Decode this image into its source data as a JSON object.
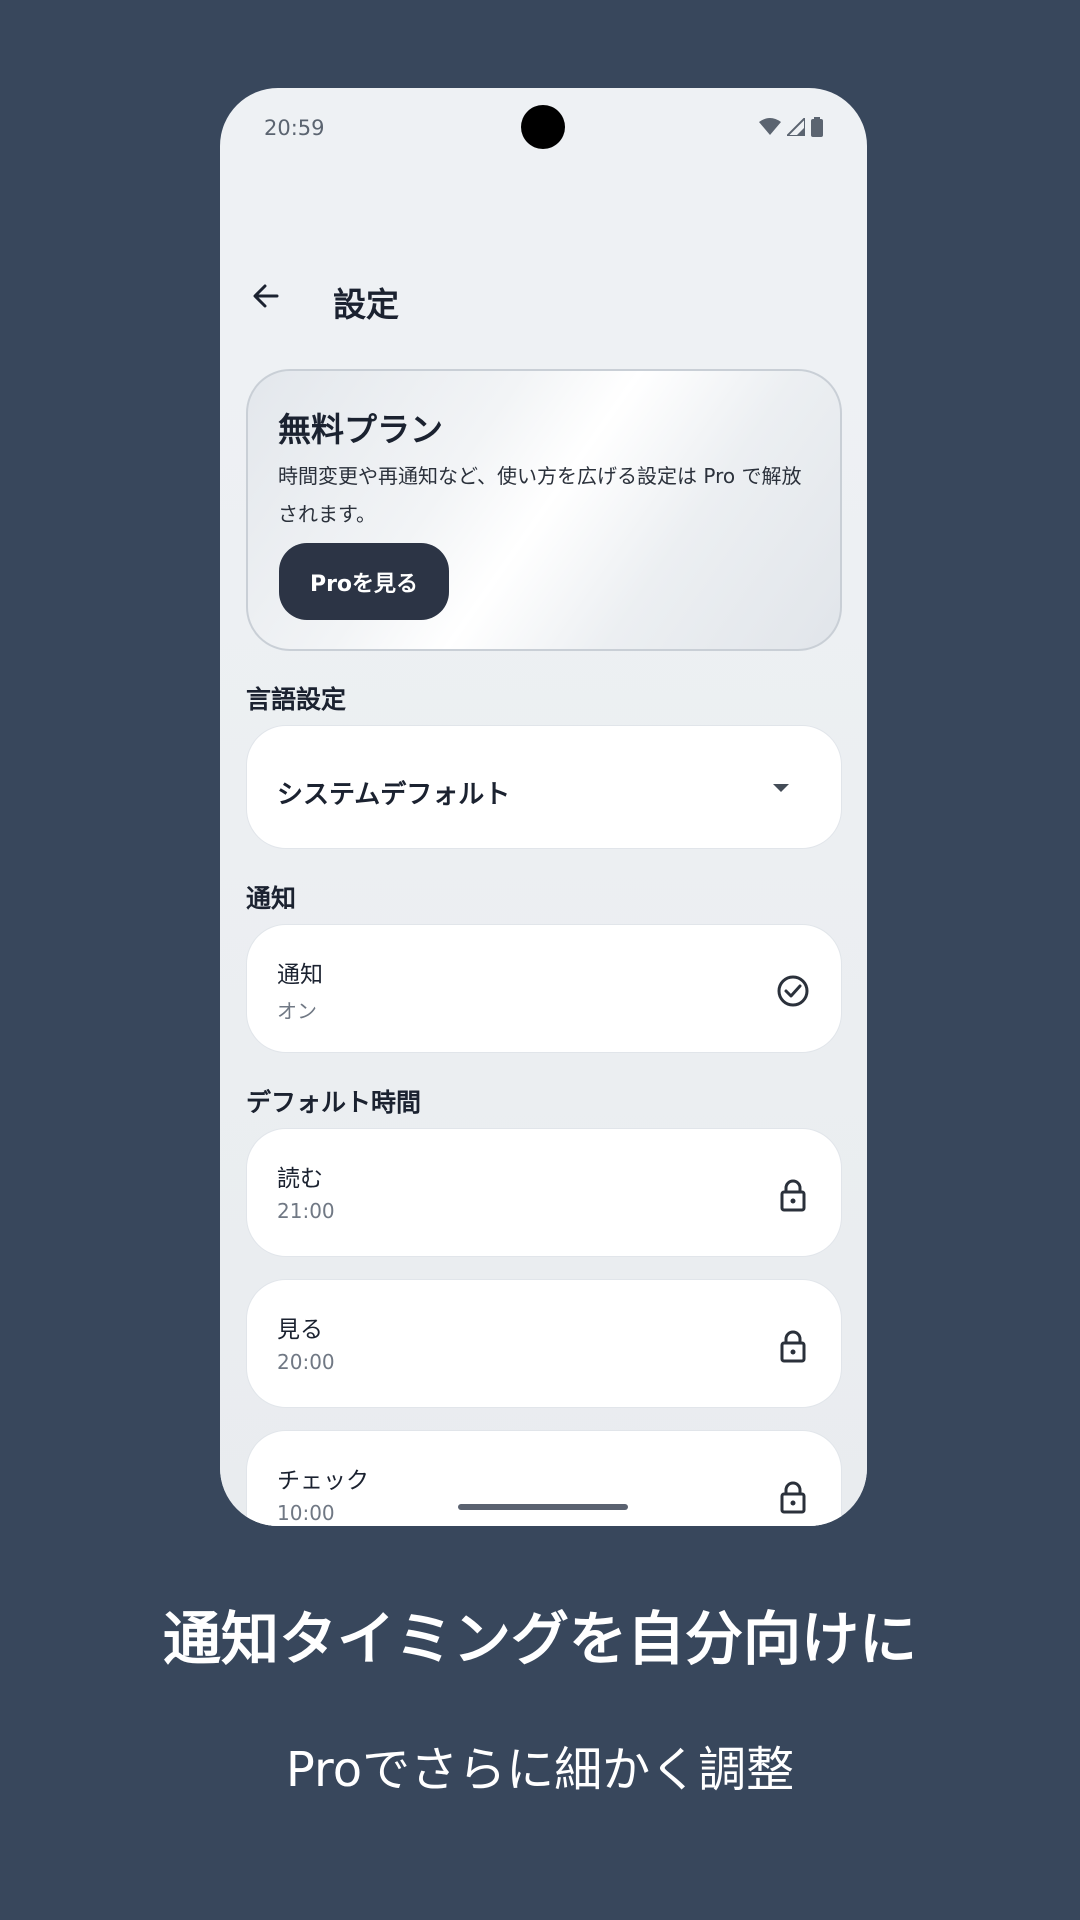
{
  "status_bar": {
    "time": "20:59"
  },
  "app_bar": {
    "title": "設定"
  },
  "plan_card": {
    "title": "無料プラン",
    "description": "時間変更や再通知など、使い方を広げる設定は Pro で解放されます。",
    "button_label": "Proを見る"
  },
  "language": {
    "section_label": "言語設定",
    "selected_value": "システムデフォルト"
  },
  "notifications": {
    "section_label": "通知",
    "item": {
      "title": "通知",
      "value": "オン",
      "icon": "check-circle-icon"
    }
  },
  "default_times": {
    "section_label": "デフォルト時間",
    "items": [
      {
        "title": "読む",
        "value": "21:00",
        "icon": "lock-icon"
      },
      {
        "title": "見る",
        "value": "20:00",
        "icon": "lock-icon"
      },
      {
        "title": "チェック",
        "value": "10:00",
        "icon": "lock-icon"
      }
    ]
  },
  "caption": {
    "title": "通知タイミングを自分向けに",
    "subtitle": "Proでさらに細かく調整"
  },
  "colors": {
    "background": "#38475c",
    "screen": "#eef1f4",
    "button": "#2c3445",
    "card": "#ffffff"
  }
}
